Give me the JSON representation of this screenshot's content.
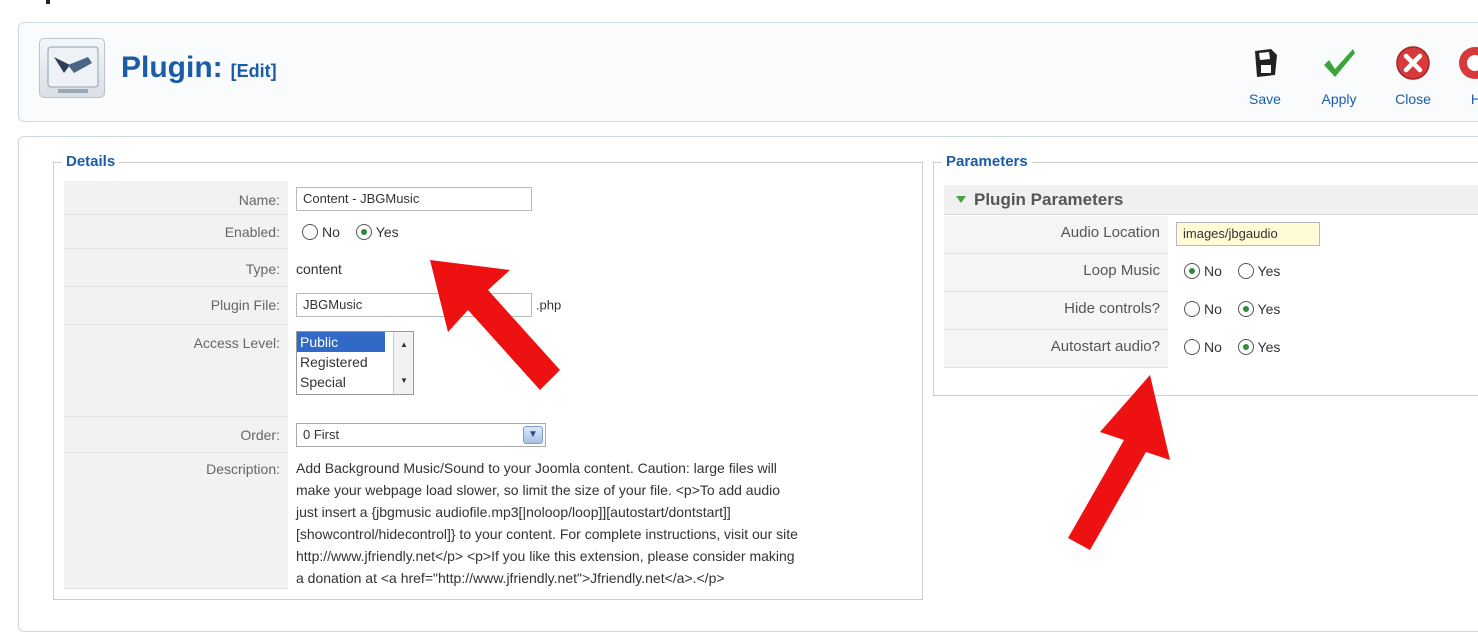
{
  "header": {
    "title": "Plugin:",
    "subtitle": "[Edit]",
    "buttons": {
      "save": "Save",
      "apply": "Apply",
      "close": "Close",
      "help": "H"
    }
  },
  "details": {
    "legend": "Details",
    "name_label": "Name:",
    "name_value": "Content - JBGMusic",
    "enabled_label": "Enabled:",
    "enabled_no": "No",
    "enabled_yes": "Yes",
    "enabled_selected": "Yes",
    "type_label": "Type:",
    "type_value": "content",
    "plugin_file_label": "Plugin File:",
    "plugin_file_value": "JBGMusic",
    "plugin_file_ext": ".php",
    "access_label": "Access Level:",
    "access_options": [
      "Public",
      "Registered",
      "Special"
    ],
    "access_selected": "Public",
    "order_label": "Order:",
    "order_value": "0 First",
    "description_label": "Description:",
    "description_lines": [
      "Add Background Music/Sound to your Joomla content. Caution: large files will",
      "make your webpage load slower, so limit the size of your file. <p>To add audio",
      "just insert a {jbgmusic audiofile.mp3[|noloop/loop]][autostart/dontstart]]",
      "[showcontrol/hidecontrol]} to your content. For complete instructions, visit our site",
      "http://www.jfriendly.net</p> <p>If you like this extension, please consider making",
      "a donation at <a href=\"http://www.jfriendly.net\">Jfriendly.net</a>.</p>"
    ]
  },
  "parameters": {
    "legend": "Parameters",
    "section_title": "Plugin Parameters",
    "audio_location_label": "Audio Location",
    "audio_location_value": "images/jbgaudio",
    "loop_label": "Loop Music",
    "loop_selected": "No",
    "hide_label": "Hide controls?",
    "hide_selected": "Yes",
    "autostart_label": "Autostart audio?",
    "autostart_selected": "Yes",
    "no": "No",
    "yes": "Yes"
  },
  "colors": {
    "title_blue": "#1a5ca8",
    "arrow_red": "#ee1111",
    "apply_green": "#3aa53a",
    "close_red": "#d63a3a"
  }
}
